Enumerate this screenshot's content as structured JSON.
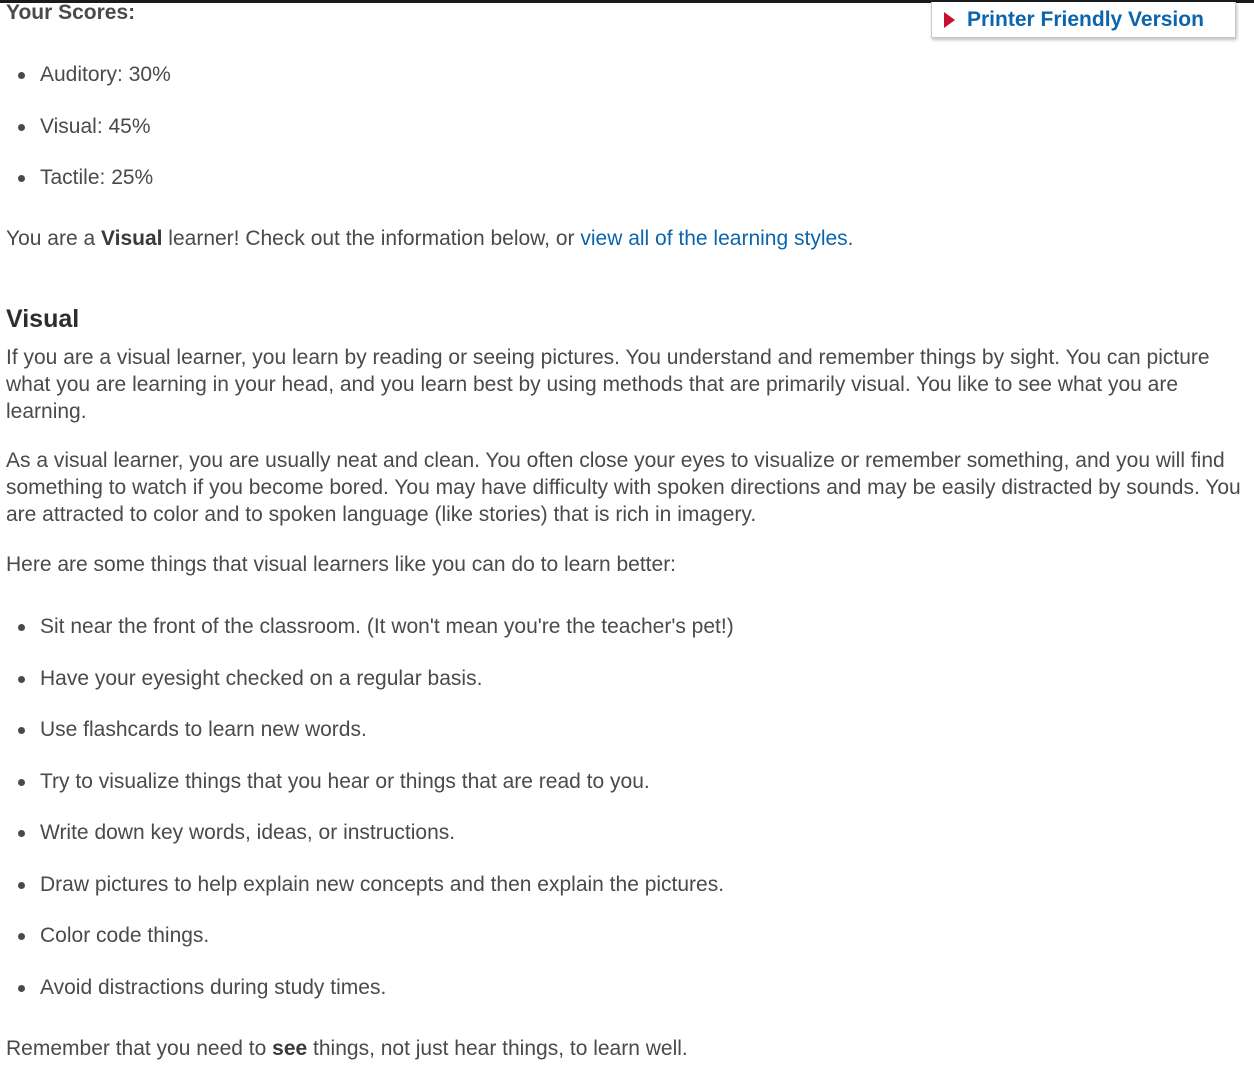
{
  "scores": {
    "title": "Your Scores:",
    "items": [
      {
        "label": "Auditory: 30%"
      },
      {
        "label": "Visual: 45%"
      },
      {
        "label": "Tactile: 25%"
      }
    ]
  },
  "printer_button": {
    "label": "Printer Friendly Version"
  },
  "intro": {
    "prefix": "You are a ",
    "emphasis": "Visual",
    "middle": " learner! Check out the information below, or ",
    "link": "view all of the learning styles",
    "suffix": "."
  },
  "section": {
    "title": "Visual",
    "paragraph1": "If you are a visual learner, you learn by reading or seeing pictures. You understand and remember things by sight. You can picture what you are learning in your head, and you learn best by using methods that are primarily visual. You like to see what you are learning.",
    "paragraph2": "As a visual learner, you are usually neat and clean. You often close your eyes to visualize or remember something, and you will find something to watch if you become bored. You may have difficulty with spoken directions and may be easily distracted by sounds. You are attracted to color and to spoken language (like stories) that is rich in imagery.",
    "paragraph3": "Here are some things that visual learners like you can do to learn better:"
  },
  "tips": [
    "Sit near the front of the classroom. (It won't mean you're the teacher's pet!)",
    "Have your eyesight checked on a regular basis.",
    "Use flashcards to learn new words.",
    "Try to visualize things that you hear or things that are read to you.",
    "Write down key words, ideas, or instructions.",
    "Draw pictures to help explain new concepts and then explain the pictures.",
    "Color code things.",
    "Avoid distractions during study times."
  ],
  "closing": {
    "prefix": "Remember that you need to ",
    "emphasis": "see",
    "suffix": " things, not just hear things, to learn well."
  },
  "colors": {
    "link": "#0c64ad",
    "text": "#4a4a4a",
    "arrow": "#c8102e"
  },
  "icons": {
    "printer_arrow": "play-arrow-icon",
    "list_bullet": "bullet-icon"
  }
}
